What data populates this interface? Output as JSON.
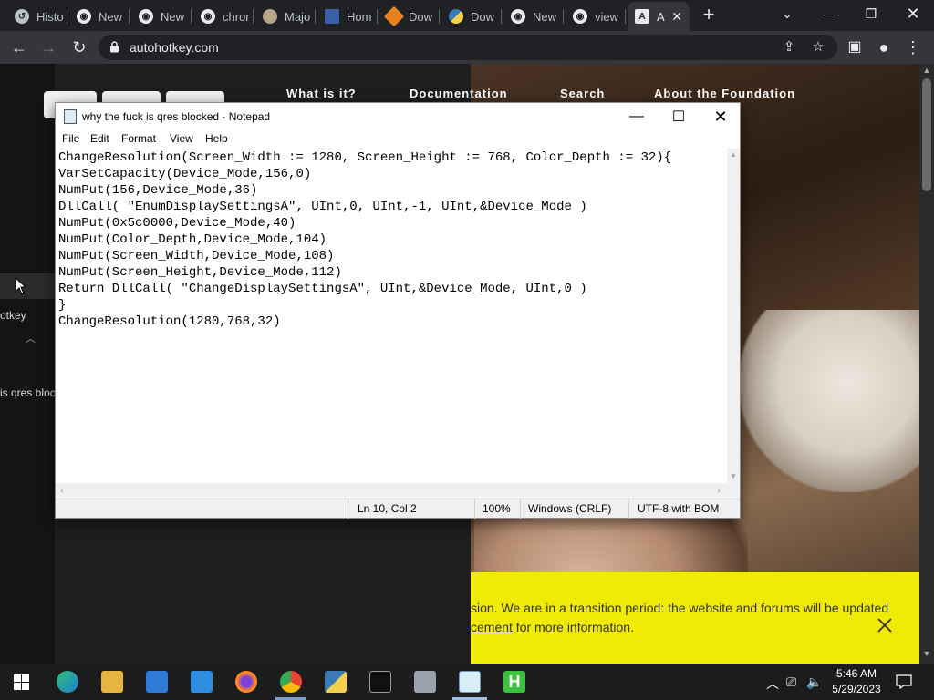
{
  "browser": {
    "tabs": [
      {
        "label": "Histo",
        "icon": "history-icon"
      },
      {
        "label": "New",
        "icon": "chrome-icon"
      },
      {
        "label": "New",
        "icon": "chrome-icon"
      },
      {
        "label": "chror",
        "icon": "chrome-icon"
      },
      {
        "label": "Majo",
        "icon": "site-icon"
      },
      {
        "label": "Hom",
        "icon": "site-icon"
      },
      {
        "label": "Dow",
        "icon": "site-icon"
      },
      {
        "label": "Dow",
        "icon": "python-icon"
      },
      {
        "label": "New",
        "icon": "chrome-icon"
      },
      {
        "label": "view",
        "icon": "chrome-icon"
      },
      {
        "label": "A",
        "icon": "autohotkey-icon"
      }
    ],
    "url": "autohotkey.com"
  },
  "page": {
    "nav": [
      "What is it?",
      "Documentation",
      "Search",
      "About the Foundation"
    ],
    "left_labels": {
      "otkey": "otkey",
      "qres": "is qres bloc"
    },
    "banner": {
      "line1": "sion. We are in a transition period: the website and forums will be updated",
      "line2_link": "cement",
      "line2_rest": " for more information."
    }
  },
  "notepad": {
    "title": "why the fuck is qres blocked - Notepad",
    "menu": [
      "File",
      "Edit",
      "Format",
      "View",
      "Help"
    ],
    "lines": [
      "ChangeResolution(Screen_Width := 1280, Screen_Height := 768, Color_Depth := 32){",
      "VarSetCapacity(Device_Mode,156,0)",
      "NumPut(156,Device_Mode,36)",
      "DllCall( \"EnumDisplaySettingsA\", UInt,0, UInt,-1, UInt,&Device_Mode )",
      "NumPut(0x5c0000,Device_Mode,40)",
      "NumPut(Color_Depth,Device_Mode,104)",
      "NumPut(Screen_Width,Device_Mode,108)",
      "NumPut(Screen_Height,Device_Mode,112)",
      "Return DllCall( \"ChangeDisplaySettingsA\", UInt,&Device_Mode, UInt,0 )",
      "}",
      "ChangeResolution(1280,768,32)"
    ],
    "status": {
      "position": "Ln 10, Col 2",
      "zoom": "100%",
      "line_ending": "Windows (CRLF)",
      "encoding": "UTF-8 with BOM"
    }
  },
  "taskbar": {
    "time": "5:46 AM",
    "date": "5/29/2023"
  }
}
